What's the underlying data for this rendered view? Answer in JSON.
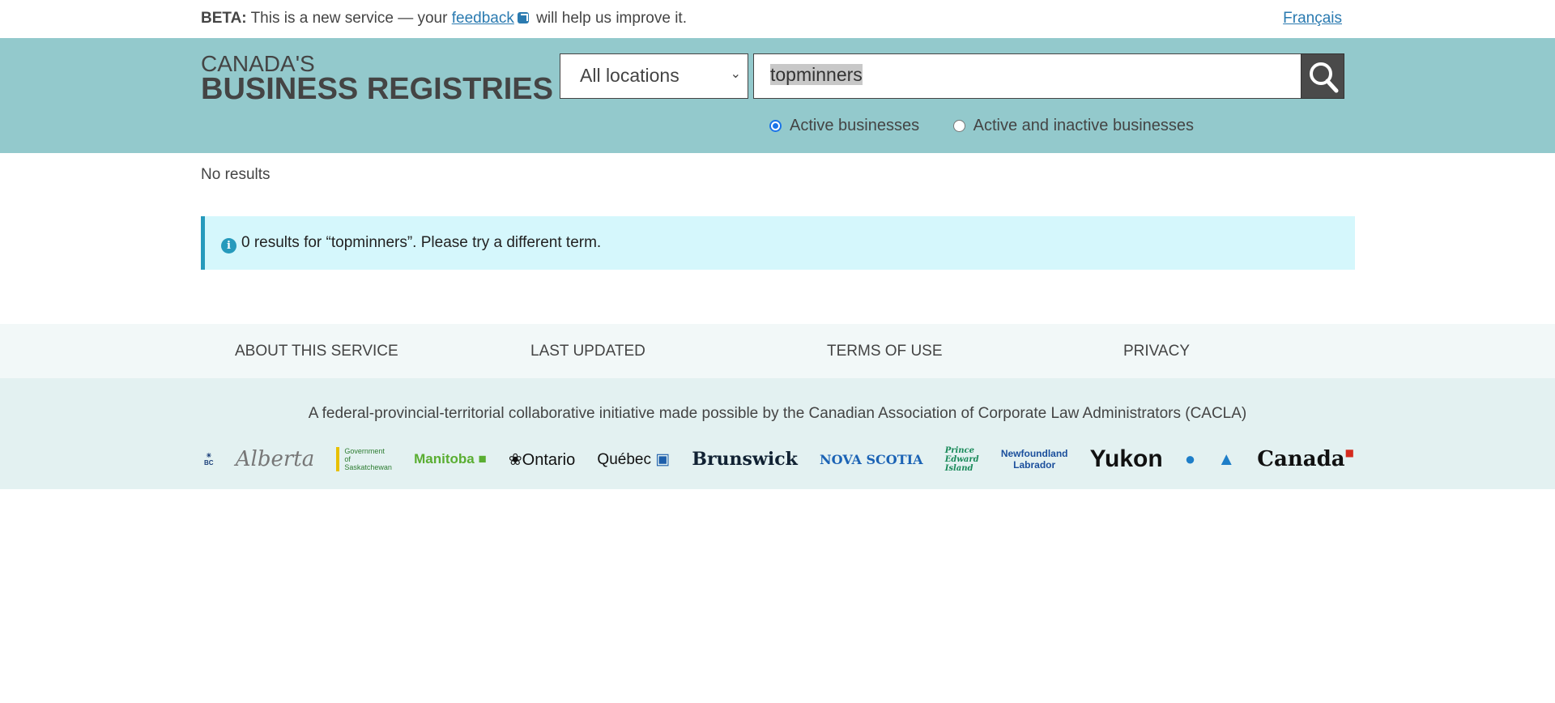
{
  "beta": {
    "label": "BETA:",
    "text_before": " This is a new service — your ",
    "link": "feedback",
    "text_after": " will help us improve it."
  },
  "lang_toggle": "Français",
  "header": {
    "logo_line1": "CANADA'S",
    "logo_line2": "BUSINESS REGISTRIES"
  },
  "search": {
    "location": "All locations",
    "query": "topminners",
    "radios": [
      {
        "label": "Active businesses",
        "checked": true
      },
      {
        "label": "Active and inactive businesses",
        "checked": false
      }
    ]
  },
  "results": {
    "summary": "No results",
    "alert": "0 results for “topminners”. Please try a different term."
  },
  "footer": {
    "links": [
      "ABOUT THIS SERVICE",
      "LAST UPDATED",
      "TERMS OF USE",
      "PRIVACY"
    ],
    "initiative": "A federal-provincial-territorial collaborative initiative made possible by the Canadian Association of Corporate Law Administrators (CACLA)",
    "logos": [
      "British Columbia",
      "Alberta",
      "Government of Saskatchewan",
      "Manitoba",
      "Ontario",
      "Québec",
      "New Brunswick / Nouveau-Brunswick",
      "Nova Scotia",
      "Prince Edward Island",
      "Newfoundland Labrador",
      "Yukon",
      "Northwest Territories",
      "Nunavut",
      "Canada"
    ]
  },
  "colors": {
    "header_bg": "#93c9cc",
    "alert_bg": "#d5f7fc",
    "alert_border": "#269abc",
    "link": "#2a7ab0"
  }
}
